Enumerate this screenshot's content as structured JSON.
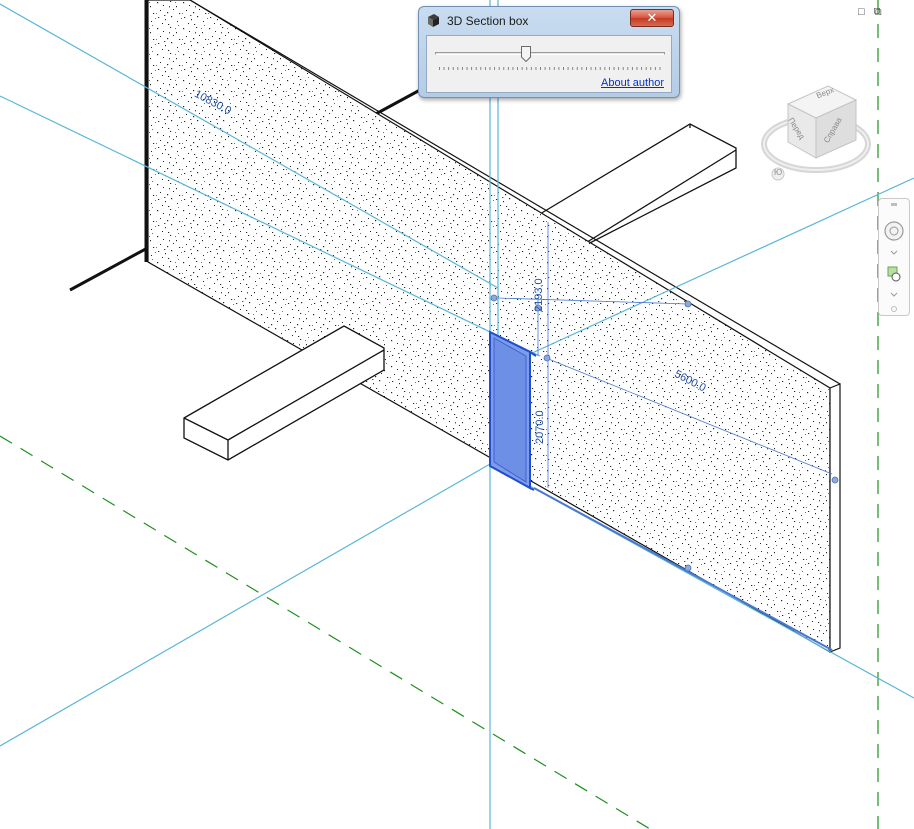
{
  "dialog": {
    "title": "3D Section box",
    "close_label": "✕",
    "icon": "cube-icon",
    "slider_value_fraction": 0.39,
    "about_link": "About author"
  },
  "dimensions": {
    "wall_length": "10830.0",
    "wall_height_upper": "2193.0",
    "wall_length_right": "5600.0",
    "opening_height": "2070.0"
  },
  "viewcube": {
    "top": "Верх",
    "front": "Перед",
    "right": "Справа",
    "compass": "Ю"
  },
  "window_controls": {
    "minimize": "□",
    "restore": "⧉"
  },
  "colors": {
    "guide_line": "#5bb6d8",
    "grid_line": "#1f8f1f",
    "selection": "#4b72d9",
    "dimension": "#1f4fa6"
  }
}
